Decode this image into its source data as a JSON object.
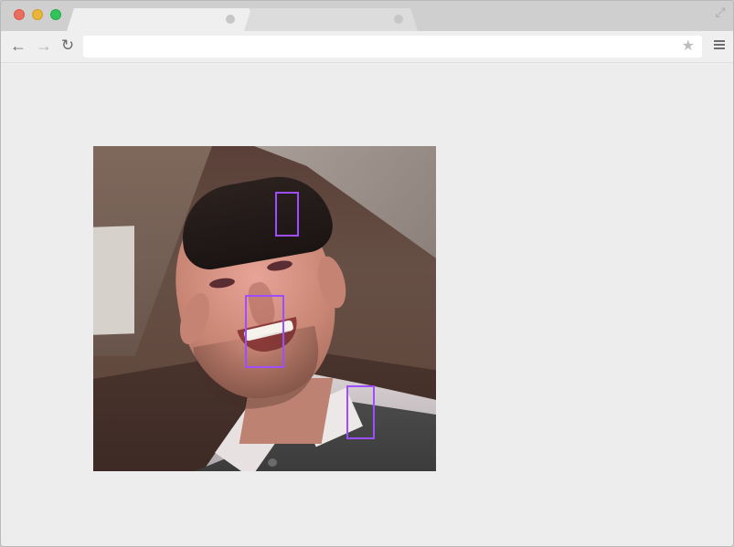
{
  "browser": {
    "address": {
      "value": "",
      "placeholder": ""
    },
    "icons": {
      "back": "left-arrow-icon",
      "forward": "right-arrow-icon",
      "reload": "reload-icon",
      "bookmark": "star-icon",
      "menu": "hamburger-menu-icon",
      "fullscreen": "fullscreen-icon"
    },
    "colors": {
      "close_button": "#e96e5f",
      "minimize_button": "#e9b53a",
      "maximize_button": "#2fc55a",
      "annotation_box": "#9d4fff"
    }
  },
  "image": {
    "description": "",
    "annotation_count": 3
  }
}
